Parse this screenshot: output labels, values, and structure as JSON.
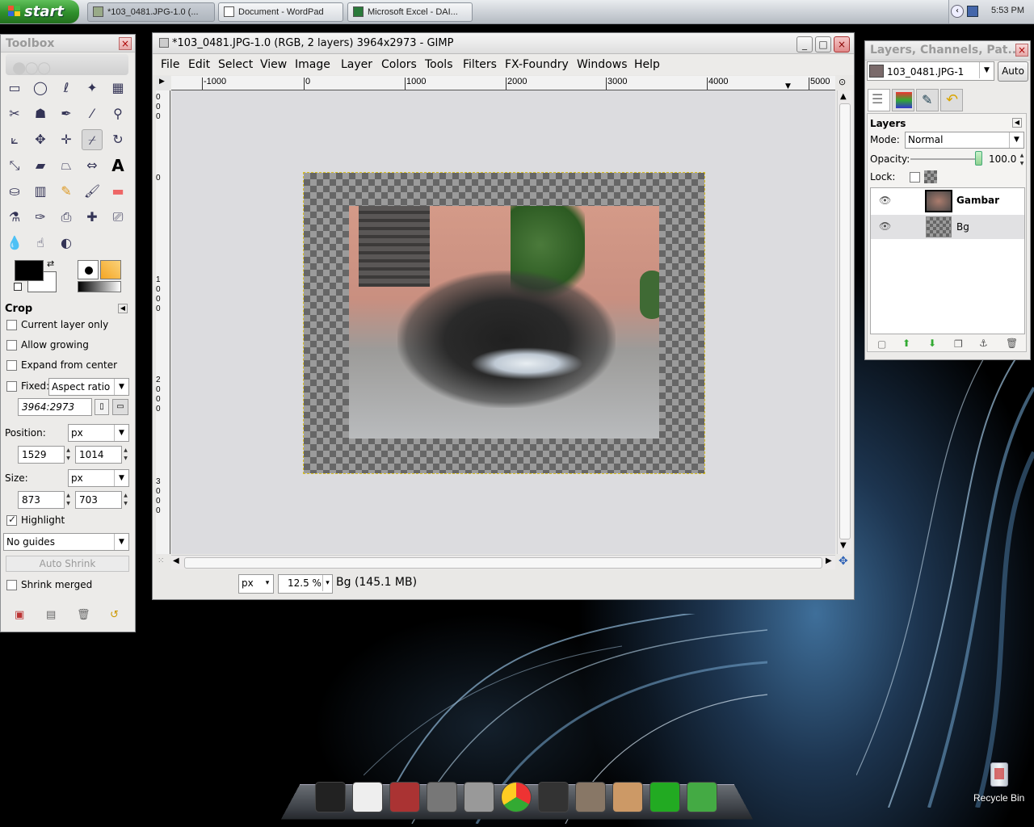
{
  "taskbar": {
    "start_label": "start",
    "tasks": [
      {
        "label": "*103_0481.JPG-1.0 (...",
        "icon": "gimp-icon",
        "active": true
      },
      {
        "label": "Document - WordPad",
        "icon": "wordpad-icon",
        "active": false
      },
      {
        "label": "Microsoft Excel - DAI...",
        "icon": "excel-icon",
        "active": false
      }
    ],
    "clock": "5:53 PM"
  },
  "toolbox": {
    "title": "Toolbox",
    "tool_options_title": "Crop",
    "options": {
      "current_layer_only": "Current layer only",
      "allow_growing": "Allow growing",
      "expand_from_center": "Expand from center",
      "fixed_label": "Fixed:",
      "fixed_value": "Aspect ratio",
      "ratio": "3964:2973",
      "position_label": "Position:",
      "position_unit": "px",
      "position_x": "1529",
      "position_y": "1014",
      "size_label": "Size:",
      "size_unit": "px",
      "size_w": "873",
      "size_h": "703",
      "highlight": "Highlight",
      "highlight_checked": true,
      "guides": "No guides",
      "auto_shrink": "Auto Shrink",
      "shrink_merged": "Shrink merged"
    },
    "tools": [
      "rect-select-icon",
      "ellipse-select-icon",
      "free-select-icon",
      "fuzzy-select-icon",
      "select-by-color-icon",
      "scissors-icon",
      "foreground-select-icon",
      "paths-icon",
      "color-picker-icon",
      "zoom-icon",
      "measure-icon",
      "move-icon",
      "align-icon",
      "crop-icon",
      "rotate-icon",
      "scale-icon",
      "shear-icon",
      "perspective-icon",
      "flip-icon",
      "text-icon",
      "bucket-fill-icon",
      "blend-icon",
      "pencil-icon",
      "paintbrush-icon",
      "eraser-icon",
      "airbrush-icon",
      "ink-icon",
      "clone-icon",
      "heal-icon",
      "perspective-clone-icon",
      "blur-icon",
      "smudge-icon",
      "dodge-burn-icon"
    ]
  },
  "image_window": {
    "title": "*103_0481.JPG-1.0 (RGB, 2 layers) 3964x2973 - GIMP",
    "menu": [
      "File",
      "Edit",
      "Select",
      "View",
      "Image",
      "Layer",
      "Colors",
      "Tools",
      "Filters",
      "FX-Foundry",
      "Windows",
      "Help"
    ],
    "ruler_h": [
      "-1000",
      "0",
      "1000",
      "2000",
      "3000",
      "4000",
      "5000"
    ],
    "ruler_v": [
      [
        "0",
        "0",
        "0"
      ],
      [
        "0"
      ],
      [
        "1",
        "0",
        "0",
        "0"
      ],
      [
        "2",
        "0",
        "0",
        "0"
      ],
      [
        "3",
        "0",
        "0",
        "0"
      ]
    ],
    "unit": "px",
    "zoom": "12.5 %",
    "status": "Bg (145.1 MB)"
  },
  "layers_panel": {
    "title": "Layers, Channels, Pat...",
    "image_select": "103_0481.JPG-1",
    "auto_label": "Auto",
    "section_title": "Layers",
    "mode_label": "Mode:",
    "mode_value": "Normal",
    "opacity_label": "Opacity:",
    "opacity_value": "100.0",
    "lock_label": "Lock:",
    "layers": [
      {
        "name": "Gambar",
        "visible": true,
        "selected": false
      },
      {
        "name": "Bg",
        "visible": true,
        "selected": true
      }
    ]
  },
  "desktop": {
    "recycle_bin_label": "Recycle Bin",
    "dock": [
      "calculator-icon",
      "notepad-icon",
      "dictionary-icon",
      "mail-icon",
      "photos-icon",
      "chrome-icon",
      "system-icon",
      "tools-icon",
      "avatar-icon",
      "monitor-icon",
      "network-icon"
    ]
  },
  "colors": {
    "accent": "#2f8f2c",
    "gimp_bg": "#dedede",
    "panel": "#ecebe9"
  }
}
